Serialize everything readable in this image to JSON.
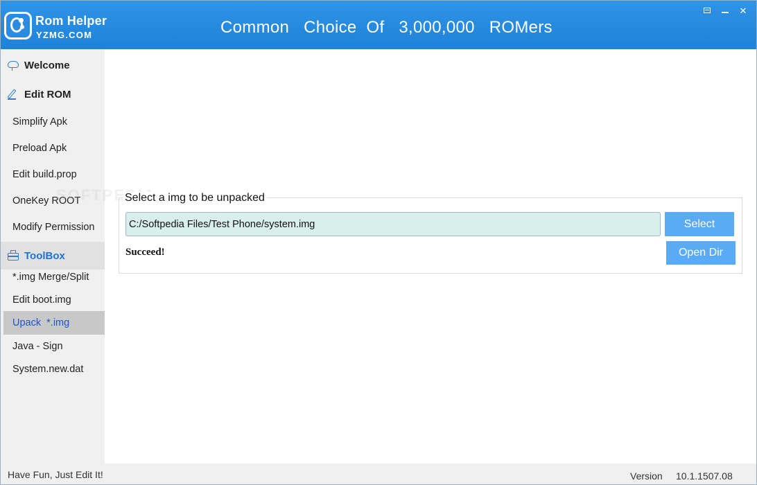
{
  "header": {
    "app_name": "Rom Helper",
    "app_site": "YZMG.COM",
    "slogan": "Common   Choice  Of   3,000,000   ROMers",
    "controls": [
      "settings-icon",
      "minimize-icon",
      "close-icon"
    ],
    "close_glyph": "✕"
  },
  "sidebar": {
    "sections": [
      {
        "label": "Welcome",
        "icon": "cloud-icon"
      },
      {
        "label": "Edit ROM",
        "icon": "pencil-icon"
      },
      {
        "label": "ToolBox",
        "icon": "toolbox-icon"
      }
    ],
    "edit_rom_items": [
      "Simplify Apk",
      "Preload Apk",
      "Edit build.prop",
      "OneKey ROOT",
      "Modify Permission"
    ],
    "toolbox_items": [
      "*.img Merge/Split",
      "Edit boot.img",
      "Upack  *.img",
      "Java - Sign",
      "System.new.dat"
    ],
    "selected_item": "Upack  *.img"
  },
  "main": {
    "group_title": "Select a img to be unpacked",
    "path_value": "C:/Softpedia Files/Test Phone/system.img",
    "select_label": "Select",
    "open_dir_label": "Open Dir",
    "status": "Succeed!",
    "watermark": "SOFTPEDIA"
  },
  "footer": {
    "left_text": "Have Fun, Just Edit It!",
    "version_label": "Version",
    "version_value": "10.1.1507.08"
  },
  "colors": {
    "header_blue": "#2088da",
    "button_blue": "#5aabf5",
    "selected_text": "#1a56c9",
    "input_bg": "#d8efec"
  }
}
